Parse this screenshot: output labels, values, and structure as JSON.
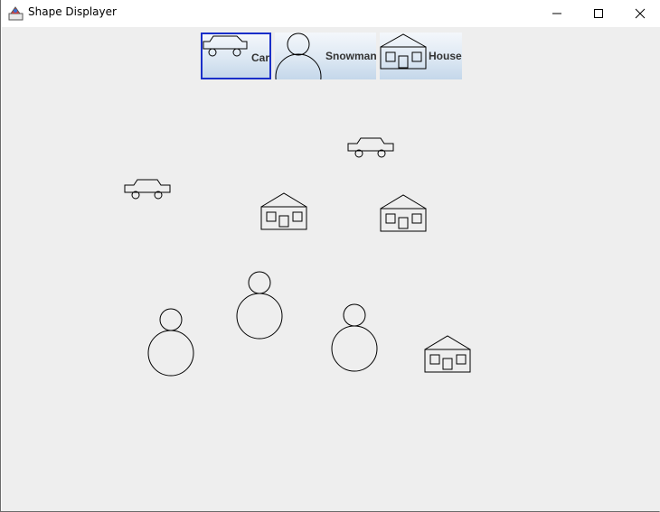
{
  "window": {
    "title": "Shape Displayer",
    "app_icon": "java-app-icon",
    "controls": [
      "minimize-icon",
      "maximize-icon",
      "close-icon"
    ]
  },
  "toolbar": {
    "buttons": [
      {
        "label": "Car",
        "icon": "car-icon",
        "selected": true
      },
      {
        "label": "Snowman",
        "icon": "snowman-icon",
        "selected": false
      },
      {
        "label": "House",
        "icon": "house-icon",
        "selected": false
      }
    ]
  },
  "canvas": {
    "shape_counts": {
      "car": 2,
      "house": 3,
      "snowman": 3
    }
  },
  "colors": {
    "canvas_bg": "#eeeeee",
    "selection_border": "#1a2fc9",
    "shape_stroke": "#000000"
  }
}
